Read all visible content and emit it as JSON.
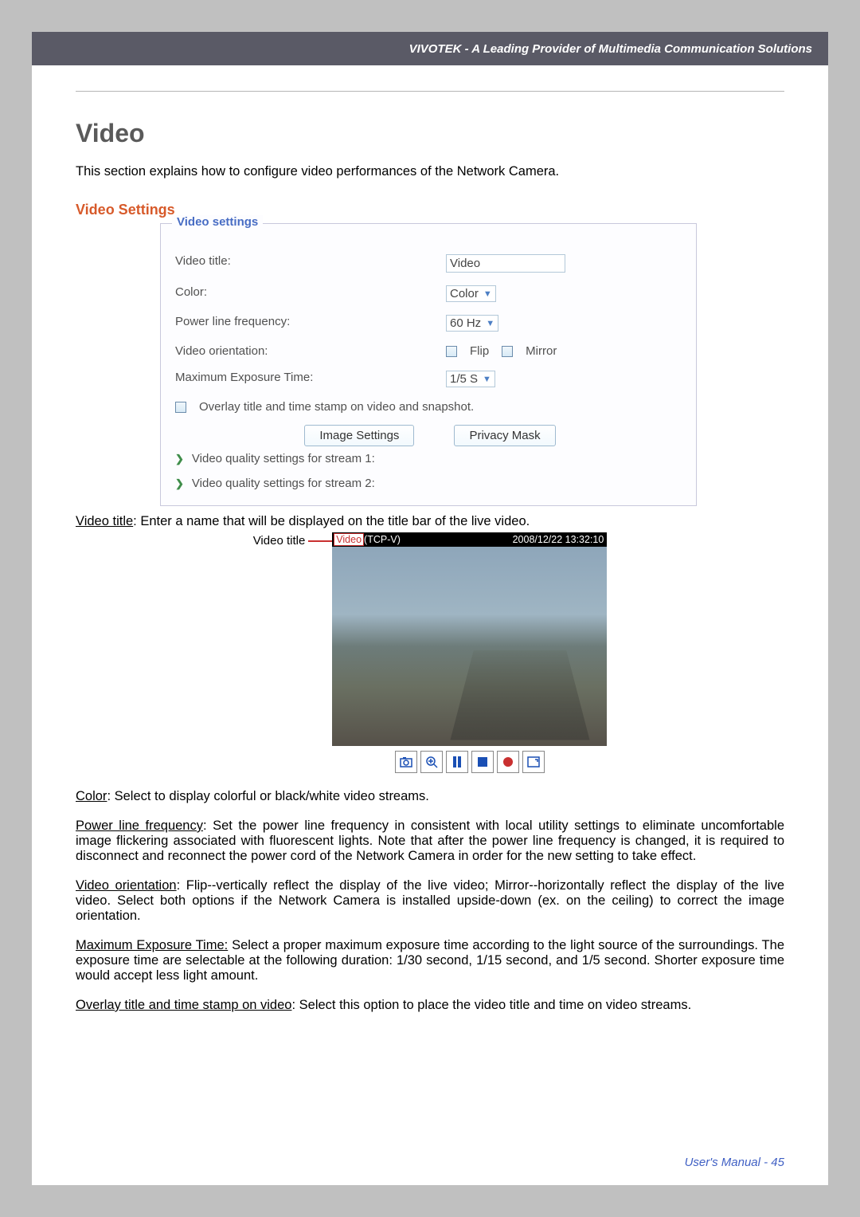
{
  "header": "VIVOTEK - A Leading Provider of Multimedia Communication Solutions",
  "title": "Video",
  "intro": "This section explains how to configure video performances of the Network Camera.",
  "subtitle": "Video Settings",
  "panel": {
    "legend": "Video settings",
    "video_title_label": "Video title:",
    "video_title_value": "Video",
    "color_label": "Color:",
    "color_value": "Color",
    "freq_label": "Power line frequency:",
    "freq_value": "60 Hz",
    "orient_label": "Video orientation:",
    "flip_label": "Flip",
    "mirror_label": "Mirror",
    "exp_label": "Maximum Exposure Time:",
    "exp_value": "1/5 S",
    "overlay_label": "Overlay title and time stamp on video and snapshot.",
    "btn_image": "Image Settings",
    "btn_mask": "Privacy Mask",
    "stream1": "Video quality settings for stream 1:",
    "stream2": "Video quality settings for stream 2:"
  },
  "preview": {
    "label": "Video title",
    "title_hl": "Video",
    "title_rest": "(TCP-V)",
    "timestamp": "2008/12/22 13:32:10"
  },
  "desc": {
    "vt_h": "Video title",
    "vt_b": ": Enter a name that will be displayed on the title bar of the live video.",
    "co_h": "Color",
    "co_b": ": Select to display colorful or black/white video streams.",
    "pf_h": "Power line frequency",
    "pf_b": ": Set the power line frequency in consistent with local utility settings to eliminate uncomfortable image flickering associated with fluorescent lights. Note that after the power line frequency is changed, it is required to disconnect and reconnect the power cord of the Network Camera in order for the new setting to take effect.",
    "vo_h": "Video orientation",
    "vo_b": ": Flip--vertically reflect the display of the live video; Mirror--horizontally reflect the display of the live video. Select both options if the Network Camera is installed upside-down (ex. on the ceiling) to correct the image orientation.",
    "me_h": "Maximum Exposure Time:",
    "me_b": " Select a proper maximum exposure time according to the light source of the surroundings. The exposure time are selectable at the following duration: 1/30 second, 1/15 second, and 1/5 second. Shorter exposure time would accept less light amount.",
    "ov_h": "Overlay title and time stamp on video",
    "ov_b": ": Select this option to place the video title and time on video streams."
  },
  "footer": "User's Manual - 45"
}
